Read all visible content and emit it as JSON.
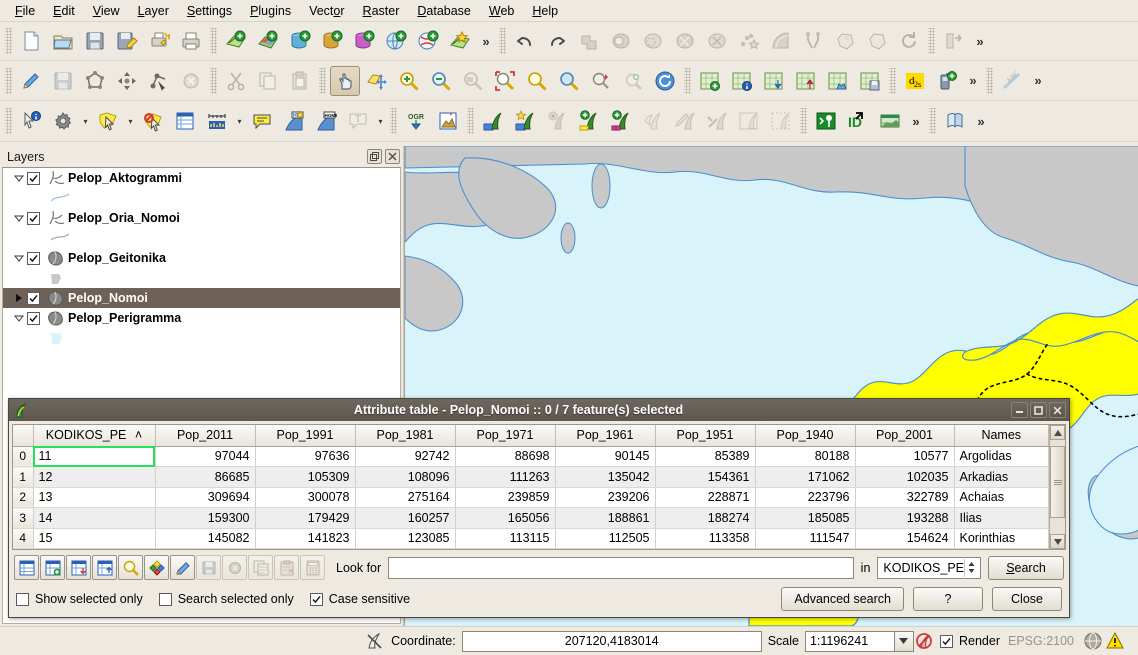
{
  "app": {
    "menus": [
      {
        "label": "File",
        "accel": "F"
      },
      {
        "label": "Edit",
        "accel": "E"
      },
      {
        "label": "View",
        "accel": "V"
      },
      {
        "label": "Layer",
        "accel": "L"
      },
      {
        "label": "Settings",
        "accel": "S"
      },
      {
        "label": "Plugins",
        "accel": "P"
      },
      {
        "label": "Vector",
        "accel": "o"
      },
      {
        "label": "Raster",
        "accel": "R"
      },
      {
        "label": "Database",
        "accel": "D"
      },
      {
        "label": "Web",
        "accel": "W"
      },
      {
        "label": "Help",
        "accel": "H"
      }
    ]
  },
  "toolbars": {
    "row1": [
      "new-project-icon",
      "open-project-icon",
      "save-project-icon",
      "save-project-as-icon",
      "new-print-composer-icon",
      "print-icon",
      "add-vector-layer-icon",
      "add-raster-layer-icon",
      "add-postgis-layer-icon",
      "add-spatialite-layer-icon",
      "add-mssql-layer-icon",
      "add-wms-layer-icon",
      "add-wcs-layer-icon",
      "add-delimited-text-layer-icon",
      "undo-icon",
      "redo-icon",
      "union-icon",
      "clip-icon",
      "difference-icon",
      "symmetrical-difference-icon",
      "intersect-icon",
      "convex-hull-icon",
      "buffer-icon",
      "dissolve-icon",
      "eliminate-icon",
      "simplify-icon",
      "rotate-icon",
      "merge-icon"
    ],
    "row2": [
      "toggle-editing-icon",
      "save-edits-icon",
      "add-feature-icon",
      "move-feature-icon",
      "node-tool-icon",
      "delete-selected-icon",
      "cut-features-icon",
      "copy-features-icon",
      "paste-features-icon",
      "pan-map-icon",
      "pan-to-selection-icon",
      "zoom-in-icon",
      "zoom-out-icon",
      "zoom-last-icon",
      "zoom-next-icon",
      "zoom-full-icon",
      "zoom-to-selection-icon",
      "zoom-to-layer-icon",
      "zoom-actual-size-icon",
      "refresh-icon",
      "new-bookmark-icon",
      "show-bookmarks-icon",
      "import-map-icon",
      "export-map-icon",
      "save-map-image-icon",
      "map-tips-icon",
      "d2s-icon",
      "gps-information-icon",
      "label-icon"
    ],
    "row3": [
      "identify-features-icon",
      "options-icon",
      "select-features-icon",
      "deselect-features-icon",
      "open-attribute-table-icon",
      "measure-line-icon",
      "annotation-icon",
      "html-annotation-icon",
      "home-annotation-icon",
      "text-annotation-icon",
      "ogr-converter-icon",
      "georeferencer-icon",
      "grass-open-mapset-icon",
      "grass-new-mapset-icon",
      "grass-close-mapset-icon",
      "grass-add-vector-icon",
      "grass-add-raster-icon",
      "grass-region-icon",
      "grass-edit-icon",
      "grass-tools-icon",
      "grass-display-region-icon",
      "grass-edit-region-icon",
      "grass-shell-icon",
      "identify-id-icon",
      "grass-mapcalc-icon",
      "openlayers-icon"
    ],
    "active": "pan-map-icon",
    "overflow_label": "»"
  },
  "layers_panel": {
    "title": "Layers",
    "float_icon": "float-panel-icon",
    "close_icon": "close-panel-icon",
    "items": [
      {
        "name": "Pelop_Aktogrammi",
        "checked": true,
        "expanded": true,
        "type": "line",
        "selected": false,
        "symbol_color": "#9dc3e6"
      },
      {
        "name": "Pelop_Oria_Nomoi",
        "checked": true,
        "expanded": true,
        "type": "line",
        "selected": false,
        "symbol_color": "#b0aba0"
      },
      {
        "name": "Pelop_Geitonika",
        "checked": true,
        "expanded": true,
        "type": "polygon",
        "selected": false,
        "symbol_color": "#c8c8c8"
      },
      {
        "name": "Pelop_Nomoi",
        "checked": true,
        "expanded": false,
        "type": "polygon",
        "selected": true,
        "symbol_color": "#ffff00"
      },
      {
        "name": "Pelop_Perigramma",
        "checked": true,
        "expanded": true,
        "type": "polygon",
        "selected": false,
        "symbol_color": "#d9f3fb"
      }
    ]
  },
  "map": {
    "sea_color": "#d9f3fb",
    "land_neighbor_color": "#c8c8c8",
    "selected_region_color": "#ffff00",
    "coastline_color": "#4a8fd0",
    "prefecture_border_color": "#000000"
  },
  "attribute_table": {
    "title": "Attribute table - Pelop_Nomoi :: 0 / 7 feature(s) selected",
    "window_icon": "qgis-leaf-icon",
    "minimize_icon": "minimize-icon",
    "maximize_icon": "maximize-icon",
    "close_icon": "close-icon",
    "sort_column": "KODIKOS_PE",
    "sort_indicator": "˄",
    "columns": [
      "KODIKOS_PE",
      "Pop_2011",
      "Pop_1991",
      "Pop_1981",
      "Pop_1971",
      "Pop_1961",
      "Pop_1951",
      "Pop_1940",
      "Pop_2001",
      "Names"
    ],
    "rows": [
      {
        "idx": "0",
        "cells": [
          "11",
          "97044",
          "97636",
          "92742",
          "88698",
          "90145",
          "85389",
          "80188",
          "10577",
          "Argolidas"
        ]
      },
      {
        "idx": "1",
        "cells": [
          "12",
          "86685",
          "105309",
          "108096",
          "111263",
          "135042",
          "154361",
          "171062",
          "102035",
          "Arkadias"
        ]
      },
      {
        "idx": "2",
        "cells": [
          "13",
          "309694",
          "300078",
          "275164",
          "239859",
          "239206",
          "228871",
          "223796",
          "322789",
          "Achaias"
        ]
      },
      {
        "idx": "3",
        "cells": [
          "14",
          "159300",
          "179429",
          "160257",
          "165056",
          "188861",
          "188274",
          "185085",
          "193288",
          "Ilias"
        ]
      },
      {
        "idx": "4",
        "cells": [
          "15",
          "145082",
          "141823",
          "123085",
          "113115",
          "112505",
          "113358",
          "111547",
          "154624",
          "Korinthias"
        ]
      }
    ],
    "focused_cell": {
      "row": 0,
      "col": 0
    },
    "tools": [
      "toggle-editing-icon",
      "new-column-icon",
      "delete-column-icon",
      "new-field-icon",
      "zoom-map-to-selected-rows-icon",
      "move-selection-to-top-icon",
      "edit-icon",
      "save-edits-icon",
      "invert-selection-icon",
      "copy-selected-icon",
      "paste-features-icon",
      "field-calculator-icon"
    ],
    "look_for_label": "Look for",
    "look_for_value": "",
    "in_label": "in",
    "field_selector_value": "KODIKOS_PE",
    "search_button": "Search",
    "search_button_accel": "S",
    "checkboxes": [
      {
        "label": "Show selected only",
        "checked": false
      },
      {
        "label": "Search selected only",
        "checked": false
      },
      {
        "label": "Case sensitive",
        "checked": true
      }
    ],
    "advanced_search_button": "Advanced search",
    "help_button": "?",
    "close_button": "Close"
  },
  "statusbar": {
    "render_icon": "stop-render-icon",
    "coordinate_label": "Coordinate:",
    "coordinate_value": "207120,4183014",
    "scale_label": "Scale",
    "scale_value": "1:1196241",
    "scale_lock_icon": "scale-lock-icon",
    "render_checkbox": {
      "label": "Render",
      "checked": true
    },
    "crs_label": "EPSG:2100",
    "crs_icon": "crs-status-icon",
    "messages_icon": "warning-messages-icon"
  }
}
